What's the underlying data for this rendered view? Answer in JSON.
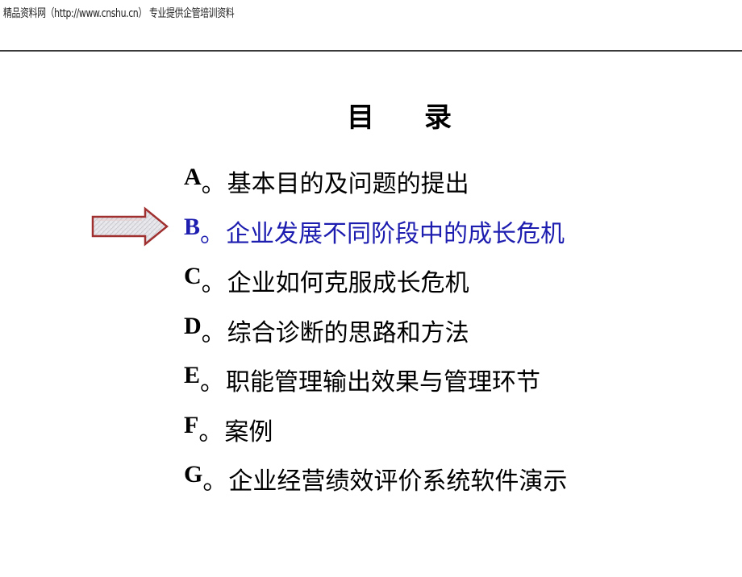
{
  "header": {
    "text": "精品资料网（http://www.cnshu.cn） 专业提供企管培训资料"
  },
  "title": {
    "char1": "目",
    "char2": "录"
  },
  "toc": {
    "separator": "。",
    "items": [
      {
        "letter": "A",
        "text": "基本目的及问题的提出",
        "active": false
      },
      {
        "letter": "B",
        "text": "企业发展不同阶段中的成长危机",
        "active": true
      },
      {
        "letter": "C",
        "text": "企业如何克服成长危机",
        "active": false
      },
      {
        "letter": "D",
        "text": "综合诊断的思路和方法",
        "active": false
      },
      {
        "letter": "E",
        "text": "职能管理输出效果与管理环节",
        "active": false
      },
      {
        "letter": "F",
        "text": "案例",
        "active": false
      },
      {
        "letter": "G",
        "text": "企业经营绩效评价系统软件演示",
        "active": false
      }
    ]
  },
  "colors": {
    "active_item": "#1d1db0",
    "normal_item": "#000000",
    "arrow_outline": "#a03030",
    "arrow_fill": "#e4e4e8"
  },
  "icons": {
    "current_marker": "right-arrow-icon"
  }
}
